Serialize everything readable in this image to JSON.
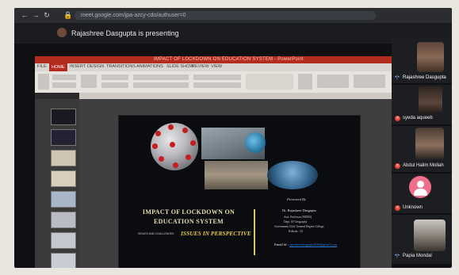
{
  "browser": {
    "url": "meet.google.com/jpa-azcy-cdo/authuser=0",
    "back_icon": "arrow-left-icon",
    "forward_icon": "arrow-right-icon",
    "reload_icon": "reload-icon",
    "lock_icon": "lock-icon"
  },
  "meet": {
    "presenting_text": "Rajashree Dasgupta is presenting"
  },
  "powerpoint": {
    "window_title": "IMPACT OF LOCKDOWN ON EDUCATION SYSTEM - PowerPoint",
    "tabs": [
      "FILE",
      "HOME",
      "INSERT",
      "DESIGN",
      "TRANSITIONS",
      "ANIMATIONS",
      "SLIDE SHOW",
      "REVIEW",
      "VIEW"
    ],
    "active_tab": "HOME"
  },
  "slide": {
    "title_line1": "IMPACT OF LOCKDOWN ON",
    "title_line2": "EDUCATION SYSTEM",
    "subtitle_small": "ISSUES AND CHALLENGES",
    "subtitle": "ISSUES IN PERSPECTIVE",
    "presented_by": "Presented By",
    "presenter_name": "Dr. Rajashree Dasgupta",
    "presenter_title": "Asst. Professor (WBES)",
    "presenter_dept": "Dept. Of Geography",
    "presenter_college": "Government Girls' General Degree College,",
    "presenter_city": "Kolkata - 23",
    "email_label": "Email id :",
    "email": "rajashreedasgupta2020@gmail.com"
  },
  "participants": [
    {
      "name": "Rajashree Dasgupta",
      "status_icon": "audio-icon"
    },
    {
      "name": "syeda aqueeb",
      "status_icon": "mic-muted-icon"
    },
    {
      "name": "Abdul Halim Mollah",
      "status_icon": "mic-muted-icon"
    },
    {
      "name": "Unknown",
      "status_icon": "mic-muted-icon"
    },
    {
      "name": "Papia Mondal",
      "status_icon": "audio-icon"
    }
  ],
  "colors": {
    "ppt_accent": "#b42b1f",
    "slide_title": "#e8dfb0",
    "slide_subtitle": "#e8c84a",
    "mute_red": "#ea4335",
    "avatar_pink": "#ee6f8a"
  }
}
